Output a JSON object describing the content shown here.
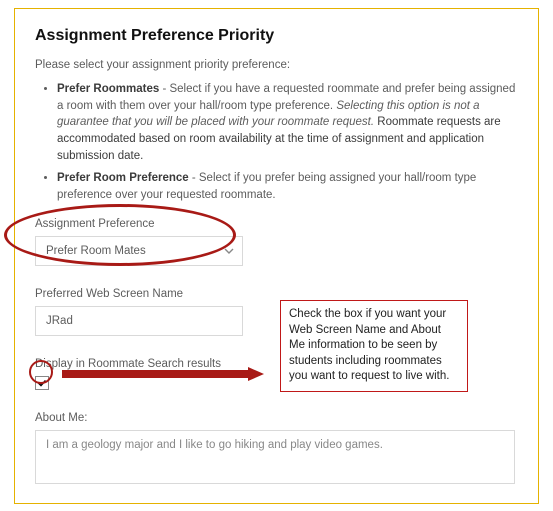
{
  "title": "Assignment Preference Priority",
  "intro": "Please select your assignment priority preference:",
  "options": [
    {
      "name": "Prefer Roommates",
      "desc_pre": " - Select if you have a requested roommate and prefer being assigned a room with them over your hall/room type preference. ",
      "desc_italic": "Selecting this option is not a guarantee that you will be placed with your roommate request.",
      "desc_post": " Roommate requests are accommodated based on room availability at the time of assignment and application submission date."
    },
    {
      "name": "Prefer Room Preference",
      "desc_pre": " - Select if you prefer being assigned your hall/room type preference over your requested roommate.",
      "desc_italic": "",
      "desc_post": ""
    }
  ],
  "fields": {
    "assignment_pref": {
      "label": "Assignment Preference",
      "selected": "Prefer Room Mates"
    },
    "screen_name": {
      "label": "Preferred Web Screen Name",
      "value": "JRad"
    },
    "display_search": {
      "label": "Display in Roommate Search results",
      "checked": true
    },
    "about": {
      "label": "About Me:",
      "value": "I am a geology major and I like to go hiking and play video games."
    }
  },
  "callout": "Check the box if you want your Web Screen Name and About Me information to be seen by students including roommates you want to request to live with.",
  "colors": {
    "annotation": "#a81a16",
    "border": "#e5b200"
  }
}
